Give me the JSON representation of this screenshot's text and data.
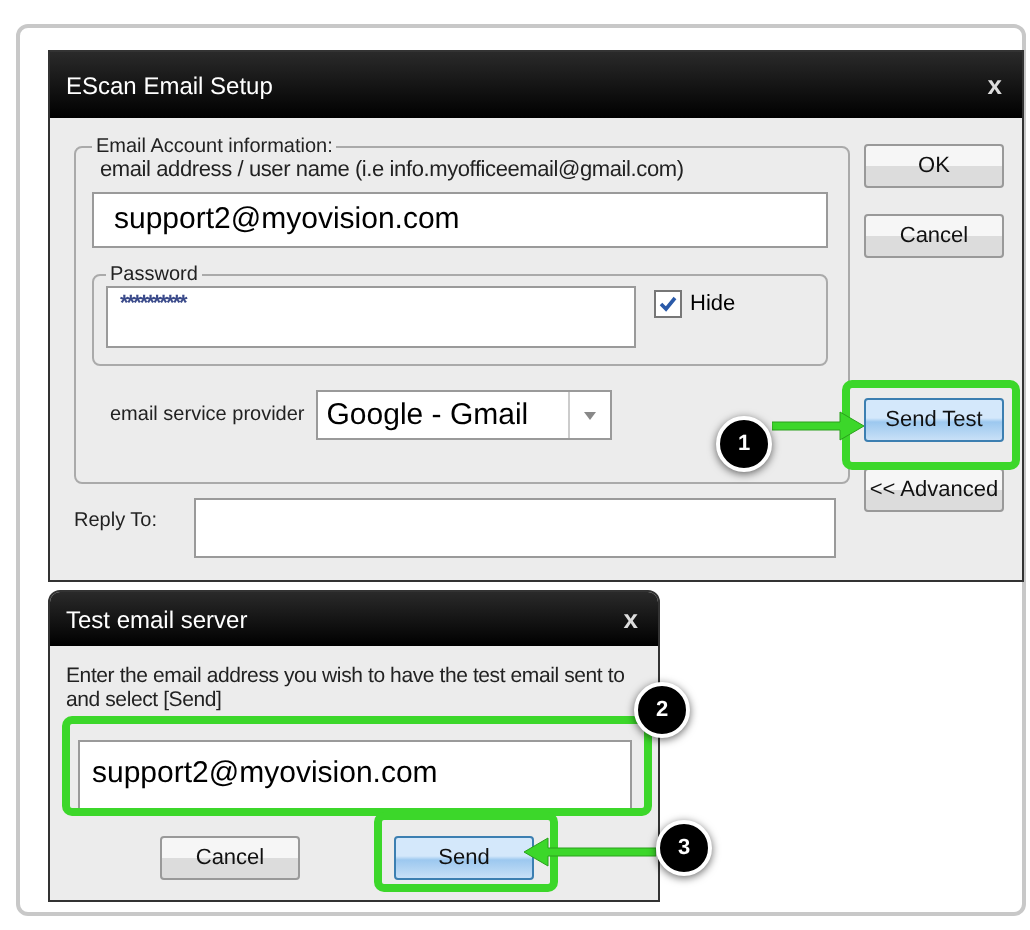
{
  "setup_dialog": {
    "title": "EScan Email Setup",
    "close": "x",
    "account_group": {
      "legend": "Email Account information:",
      "hint": "email address / user name (i.e info.myofficeemail@gmail.com)",
      "email": "support2@myovision.com",
      "password_group": {
        "legend": "Password",
        "value": "**********",
        "hide": {
          "label": "Hide",
          "checked": true
        }
      },
      "provider": {
        "label": "email service provider",
        "value": "Google - Gmail"
      }
    },
    "reply_to": {
      "label": "Reply To:"
    },
    "buttons": [
      {
        "label": "OK",
        "highlighted": false
      },
      {
        "label": "Cancel",
        "highlighted": false
      },
      {
        "label": "Send Test",
        "highlighted": true
      },
      {
        "label": "<< Advanced",
        "highlighted": false
      }
    ]
  },
  "test_dialog": {
    "title": "Test email server",
    "close": "x",
    "instruction": "Enter the email address you wish to have the test email sent to and select [Send]",
    "email": "support2@myovision.com",
    "buttons": [
      {
        "label": "Cancel",
        "highlighted": false
      },
      {
        "label": "Send",
        "highlighted": true
      }
    ]
  },
  "callouts": [
    {
      "number": "1"
    },
    {
      "number": "2"
    },
    {
      "number": "3"
    }
  ]
}
